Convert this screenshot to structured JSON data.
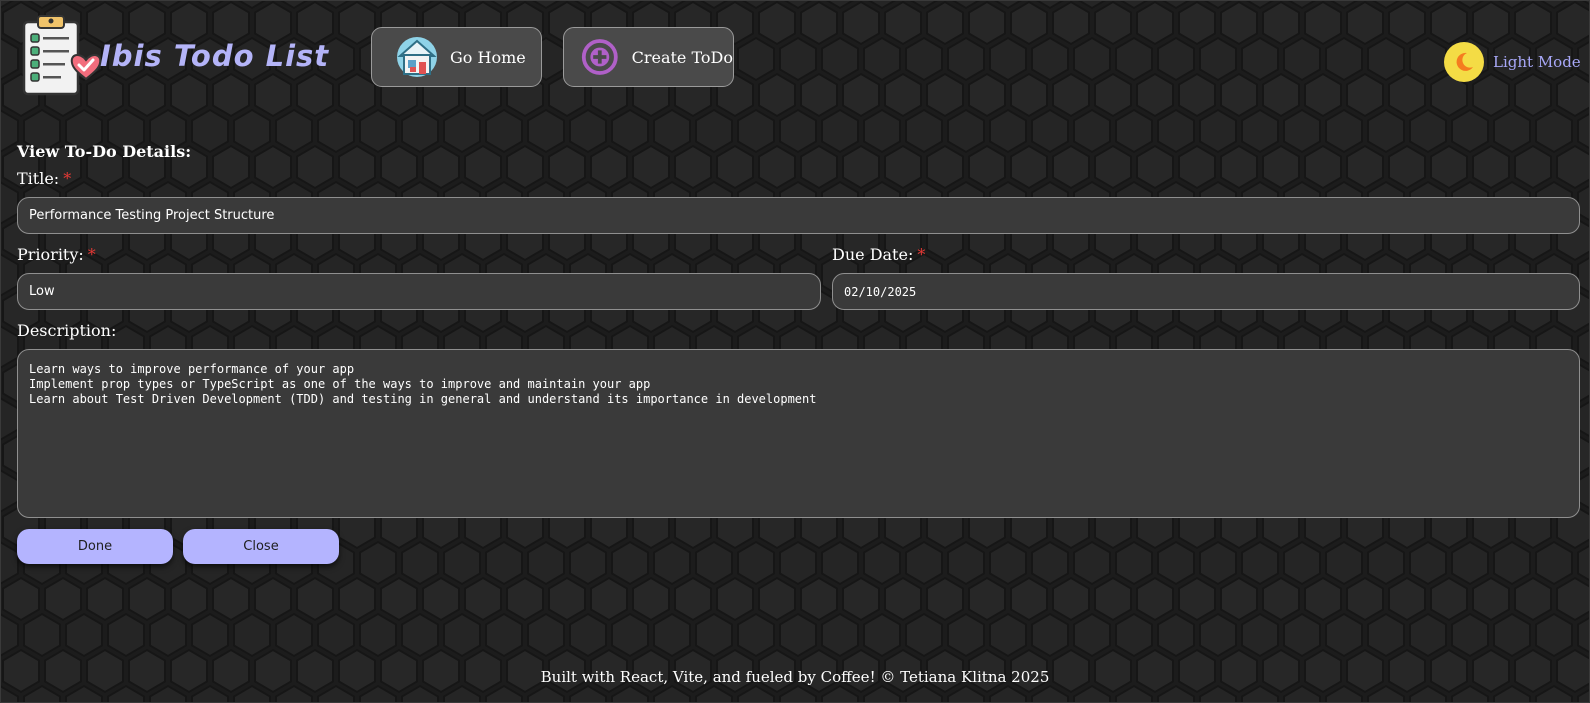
{
  "colors": {
    "background": "#1e1e1e",
    "brand": "#b4b4f8",
    "button_fill": "#b4b4ff",
    "input_fill": "#3a3a3a",
    "required_marker": "#e53935",
    "moon_circle": "#f4dc45",
    "create_icon": "#b060c8"
  },
  "header": {
    "logo_icon": "clipboard-checklist-heart-icon",
    "title": "Ibis Todo List",
    "nav": [
      {
        "label": "Go Home",
        "icon": "house-icon"
      },
      {
        "label": "Create ToDo",
        "icon": "plus-circle-icon"
      }
    ],
    "theme_toggle": {
      "label": "Light Mode",
      "icon": "moon-icon"
    }
  },
  "form": {
    "heading": "View To-Do Details:",
    "required_mark": "*",
    "title": {
      "label": "Title:",
      "value": "Performance Testing Project Structure"
    },
    "priority": {
      "label": "Priority:",
      "value": "Low"
    },
    "due_date": {
      "label": "Due Date:",
      "value": "02/10/2025"
    },
    "description": {
      "label": "Description:",
      "lines": [
        "Learn ways to improve performance of your app",
        "Implement prop types or TypeScript as one of the ways to improve and maintain your app",
        "Learn about Test Driven Development (TDD) and testing in general and understand its importance in development"
      ]
    },
    "buttons": {
      "done": "Done",
      "close": "Close"
    }
  },
  "footer": {
    "text": "Built with React, Vite, and fueled by Coffee! © Tetiana Klitna 2025"
  }
}
